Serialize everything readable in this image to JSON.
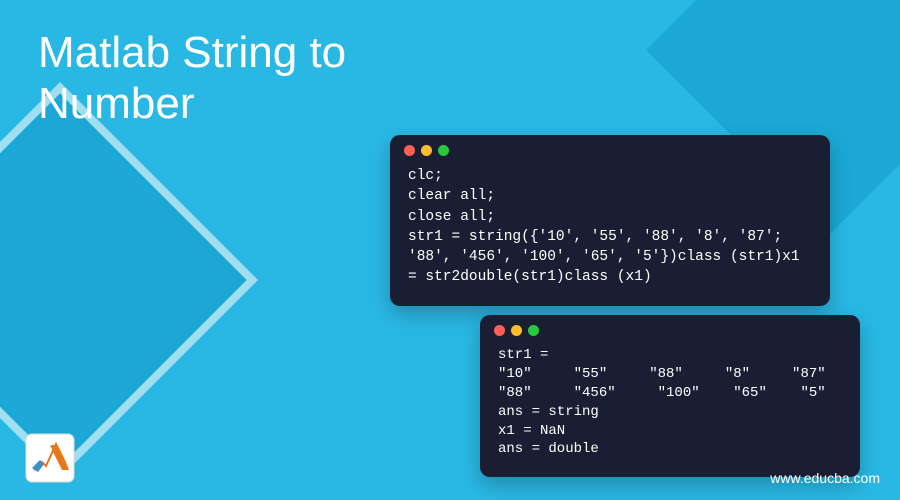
{
  "title_line1": "Matlab String to",
  "title_line2": "Number",
  "code1": "clc;\nclear all;\nclose all;\nstr1 = string({'10', '55', '88', '8', '87'; '88', '456', '100', '65', '5'})class (str1)x1 = str2double(str1)class (x1)",
  "code2": "str1 =\n\"10\"     \"55\"     \"88\"     \"8\"     \"87\"\n\"88\"     \"456\"     \"100\"    \"65\"    \"5\"\nans = string\nx1 = NaN\nans = double",
  "watermark": "www.educba.com",
  "colors": {
    "background": "#29b8e4",
    "accent": "#1ba8d6",
    "code_bg": "#1a1e33",
    "text": "#ffffff"
  }
}
